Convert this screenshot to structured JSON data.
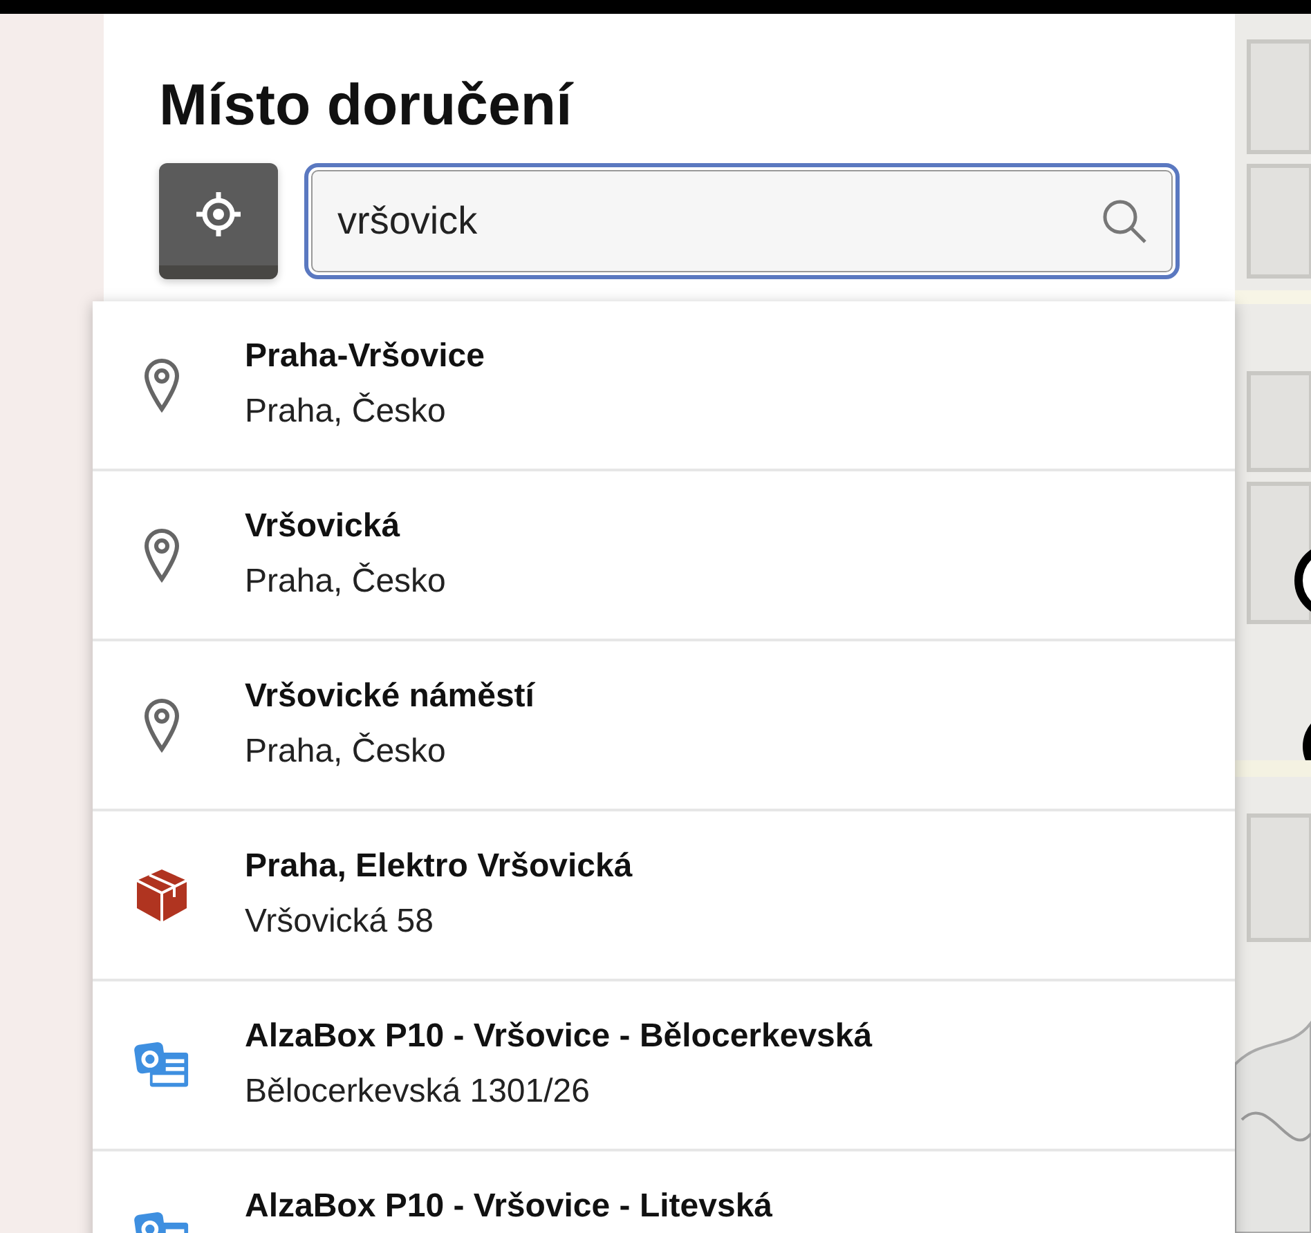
{
  "title": "Místo doručení",
  "search": {
    "value": "vršovick"
  },
  "results": [
    {
      "kind": "place",
      "name": "Praha-Vršovice",
      "address": "Praha, Česko"
    },
    {
      "kind": "place",
      "name": "Vršovická",
      "address": "Praha, Česko"
    },
    {
      "kind": "place",
      "name": "Vršovické náměstí",
      "address": "Praha, Česko"
    },
    {
      "kind": "depot",
      "name": "Praha, Elektro Vršovická",
      "address": "Vršovická 58"
    },
    {
      "kind": "box",
      "name": "AlzaBox P10 - Vršovice - Bělocerkevská",
      "address": "Bělocerkevská 1301/26"
    },
    {
      "kind": "box",
      "name": "AlzaBox P10 - Vršovice - Litevská"
    }
  ]
}
